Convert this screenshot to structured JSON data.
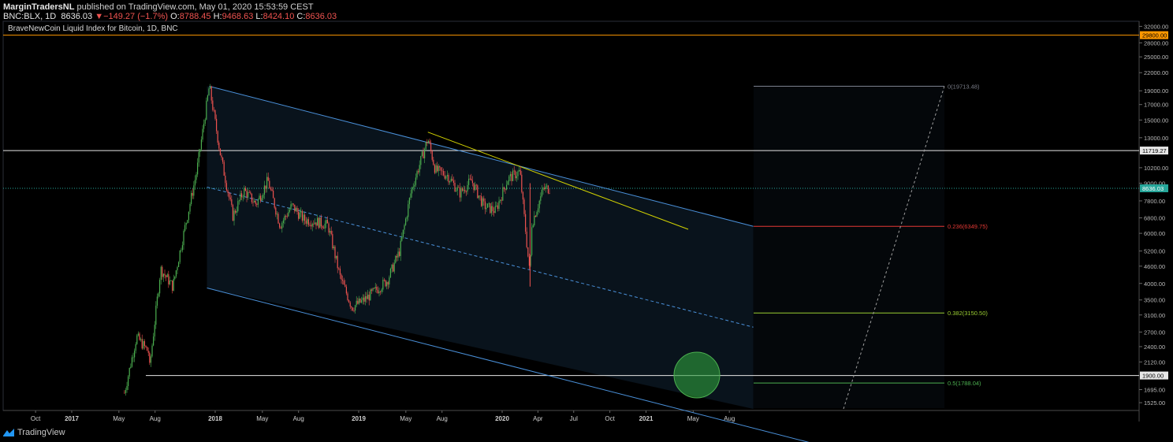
{
  "header": {
    "author": "MarginTradersNL",
    "published_text": "published on TradingView.com, May 01, 2020 15:53:59 CEST",
    "symbol": "BNC:BLX, 1D",
    "last": "8636.03",
    "change_arrow": "▼",
    "change": "−149.27 (−1.7%)",
    "o_label": "O:",
    "o_val": "8788.45",
    "h_label": "H:",
    "h_val": "9468.63",
    "l_label": "L:",
    "l_val": "8424.10",
    "c_label": "C:",
    "c_val": "8636.03"
  },
  "footer": {
    "brand": "TradingView",
    "icon": "tradingview-logo-icon"
  },
  "colors": {
    "background": "#000000",
    "candle_up": "#4caf50",
    "candle_down": "#ef5350",
    "channel": "#4a90d9",
    "trendline": "#d4d400",
    "fib_0": "#787b86",
    "fib_236": "#e53935",
    "fib_382": "#9acd32",
    "fib_5": "#4caf50",
    "price_line": "#26a69a",
    "orange_level": "#ff9800",
    "target_circle": "#2e7d32"
  },
  "chart_data": {
    "type": "candlestick",
    "title": "BraveNewCoin Liquid Index for Bitcoin, 1D, BNC",
    "y_scale": "log",
    "ylim": [
      1450,
      32500
    ],
    "y_ticks": [
      "32000.00",
      "28000.00",
      "25000.00",
      "22000.00",
      "19000.00",
      "17000.00",
      "15000.00",
      "13000.00",
      "10200.00",
      "9000.00",
      "7800.00",
      "6800.00",
      "6000.00",
      "5200.00",
      "4600.00",
      "4000.00",
      "3500.00",
      "3100.00",
      "2700.00",
      "2400.00",
      "2120.00",
      "1695.00",
      "1525.00"
    ],
    "x_ticks": [
      "Oct",
      "2017",
      "May",
      "Aug",
      "2018",
      "May",
      "Aug",
      "2019",
      "May",
      "Aug",
      "2020",
      "Apr",
      "Jul",
      "Oct",
      "2021",
      "May",
      "Aug"
    ],
    "series_approx_close": [
      {
        "date": "2017-05",
        "close": 1650
      },
      {
        "date": "2017-06",
        "close": 2600
      },
      {
        "date": "2017-07",
        "close": 2300
      },
      {
        "date": "2017-07-16",
        "close": 1900
      },
      {
        "date": "2017-08",
        "close": 4500
      },
      {
        "date": "2017-09",
        "close": 3900
      },
      {
        "date": "2017-10",
        "close": 6200
      },
      {
        "date": "2017-11",
        "close": 9900
      },
      {
        "date": "2017-12-17",
        "close": 19713
      },
      {
        "date": "2018-01",
        "close": 11200
      },
      {
        "date": "2018-02",
        "close": 6900
      },
      {
        "date": "2018-03",
        "close": 8500
      },
      {
        "date": "2018-04",
        "close": 7600
      },
      {
        "date": "2018-05",
        "close": 9200
      },
      {
        "date": "2018-06",
        "close": 6400
      },
      {
        "date": "2018-07",
        "close": 7500
      },
      {
        "date": "2018-08",
        "close": 6700
      },
      {
        "date": "2018-09",
        "close": 6600
      },
      {
        "date": "2018-10",
        "close": 6400
      },
      {
        "date": "2018-11",
        "close": 4200
      },
      {
        "date": "2018-12",
        "close": 3300
      },
      {
        "date": "2019-01",
        "close": 3500
      },
      {
        "date": "2019-02",
        "close": 3800
      },
      {
        "date": "2019-03",
        "close": 4100
      },
      {
        "date": "2019-04",
        "close": 5200
      },
      {
        "date": "2019-05",
        "close": 8500
      },
      {
        "date": "2019-06-26",
        "close": 12900
      },
      {
        "date": "2019-07",
        "close": 10000
      },
      {
        "date": "2019-08",
        "close": 9600
      },
      {
        "date": "2019-09",
        "close": 8300
      },
      {
        "date": "2019-10",
        "close": 9200
      },
      {
        "date": "2019-11",
        "close": 7500
      },
      {
        "date": "2019-12",
        "close": 7200
      },
      {
        "date": "2020-01",
        "close": 9300
      },
      {
        "date": "2020-02",
        "close": 9900
      },
      {
        "date": "2020-03-12",
        "close": 4200
      },
      {
        "date": "2020-03",
        "close": 6400
      },
      {
        "date": "2020-04",
        "close": 8600
      },
      {
        "date": "2020-05-01",
        "close": 8636.03
      }
    ],
    "levels": [
      {
        "label": "29800.00",
        "value": 29800,
        "color": "orange"
      },
      {
        "label": "11719.27",
        "value": 11719.27,
        "color": "white"
      },
      {
        "label": "8636.03",
        "value": 8636.03,
        "color": "green"
      },
      {
        "label": "1900.00",
        "value": 1900,
        "color": "white"
      }
    ],
    "fib_levels": [
      {
        "label": "0(19713.48)",
        "value": 19713.48
      },
      {
        "label": "0.236(6349.75)",
        "value": 6349.75
      },
      {
        "label": "0.382(3150.50)",
        "value": 3150.5
      },
      {
        "label": "0.5(1788.04)",
        "value": 1788.04
      }
    ]
  }
}
